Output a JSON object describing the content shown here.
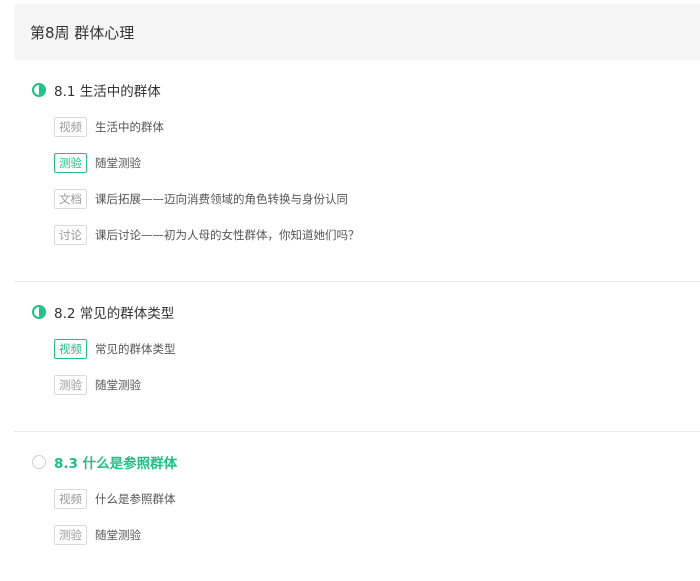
{
  "week": {
    "title": "第8周 群体心理"
  },
  "colors": {
    "accent": "#1fbf86",
    "header_bg": "#f5f5f5",
    "tag_border": "#d9d9d9",
    "divider": "#e8e8e8"
  },
  "chapters": [
    {
      "title": "8.1 生活中的群体",
      "status": "half-complete-icon",
      "units": [
        {
          "type": "视频",
          "label": "生活中的群体",
          "done": false
        },
        {
          "type": "测验",
          "label": "随堂测验",
          "done": true
        },
        {
          "type": "文档",
          "label": "课后拓展——迈向消费领域的角色转换与身份认同",
          "done": false
        },
        {
          "type": "讨论",
          "label": "课后讨论——初为人母的女性群体，你知道她们吗？",
          "done": false
        }
      ]
    },
    {
      "title": "8.2 常见的群体类型",
      "status": "half-complete-icon",
      "units": [
        {
          "type": "视频",
          "label": "常见的群体类型",
          "done": true
        },
        {
          "type": "测验",
          "label": "随堂测验",
          "done": false
        }
      ]
    },
    {
      "title": "8.3 什么是参照群体",
      "status": "empty-circle-icon",
      "active": true,
      "units": [
        {
          "type": "视频",
          "label": "什么是参照群体",
          "done": false
        },
        {
          "type": "测验",
          "label": "随堂测验",
          "done": false
        }
      ]
    }
  ]
}
